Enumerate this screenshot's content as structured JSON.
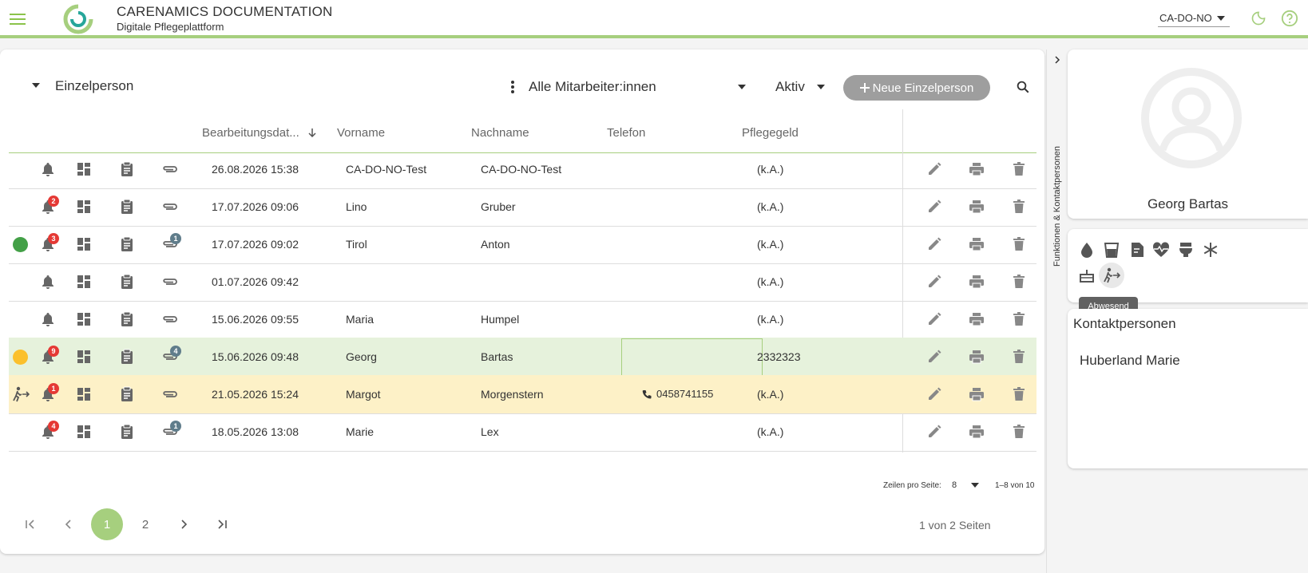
{
  "header": {
    "title": "CARENAMICS DOCUMENTATION",
    "subtitle": "Digitale Pflegeplattform",
    "tenant": "CA-DO-NO",
    "accent_color": "#a6cf7e"
  },
  "toolbar": {
    "entity_label": "Einzelperson",
    "staff_filter": "Alle Mitarbeiter:innen",
    "status_filter": "Aktiv",
    "new_button_label": "Neue Einzelperson"
  },
  "table": {
    "columns": {
      "date": "Bearbeitungsdat...",
      "first_name": "Vorname",
      "last_name": "Nachname",
      "phone": "Telefon",
      "care": "Pflegegeld"
    },
    "rows": [
      {
        "status": "",
        "away": false,
        "notifications": "",
        "attachments": "",
        "date": "26.08.2026 15:38",
        "first_name": "CA-DO-NO-Test",
        "last_name": "CA-DO-NO-Test",
        "phone": "",
        "care": "(k.A.)"
      },
      {
        "status": "",
        "away": false,
        "notifications": "2",
        "attachments": "",
        "date": "17.07.2026 09:06",
        "first_name": "Lino",
        "last_name": "Gruber",
        "phone": "",
        "care": "(k.A.)"
      },
      {
        "status": "#43a047",
        "away": false,
        "notifications": "3",
        "attachments": "1",
        "date": "17.07.2026 09:02",
        "first_name": "Tirol",
        "last_name": "Anton",
        "phone": "",
        "care": "(k.A.)"
      },
      {
        "status": "",
        "away": false,
        "notifications": "",
        "attachments": "",
        "date": "01.07.2026 09:42",
        "first_name": "",
        "last_name": "",
        "phone": "",
        "care": "(k.A.)"
      },
      {
        "status": "",
        "away": false,
        "notifications": "",
        "attachments": "",
        "date": "15.06.2026 09:55",
        "first_name": "Maria",
        "last_name": "Humpel",
        "phone": "",
        "care": "(k.A.)"
      },
      {
        "status": "#fbc02d",
        "away": false,
        "notifications": "9",
        "attachments": "4",
        "date": "15.06.2026 09:48",
        "first_name": "Georg",
        "last_name": "Bartas",
        "phone": "",
        "care": "2332323"
      },
      {
        "status": "",
        "away": true,
        "notifications": "1",
        "attachments": "",
        "date": "21.05.2026 15:24",
        "first_name": "Margot",
        "last_name": "Morgenstern",
        "phone": "0458741155",
        "care": "(k.A.)"
      },
      {
        "status": "",
        "away": false,
        "notifications": "4",
        "attachments": "1",
        "date": "18.05.2026 13:08",
        "first_name": "Marie",
        "last_name": "Lex",
        "phone": "",
        "care": "(k.A.)"
      }
    ]
  },
  "pagination": {
    "rows_per_page_label": "Zeilen pro Seite:",
    "rows_per_page": "8",
    "range": "1–8 von 10",
    "pages": [
      "1",
      "2"
    ],
    "current_page": "1",
    "pages_info": "1 von 2 Seiten"
  },
  "side": {
    "tab_label": "Funktionen & Kontaktpersonen",
    "person_name": "Georg Bartas",
    "tooltip": "Abwesend",
    "contacts_title": "Kontaktpersonen",
    "contacts": [
      "Huberland Marie"
    ]
  }
}
